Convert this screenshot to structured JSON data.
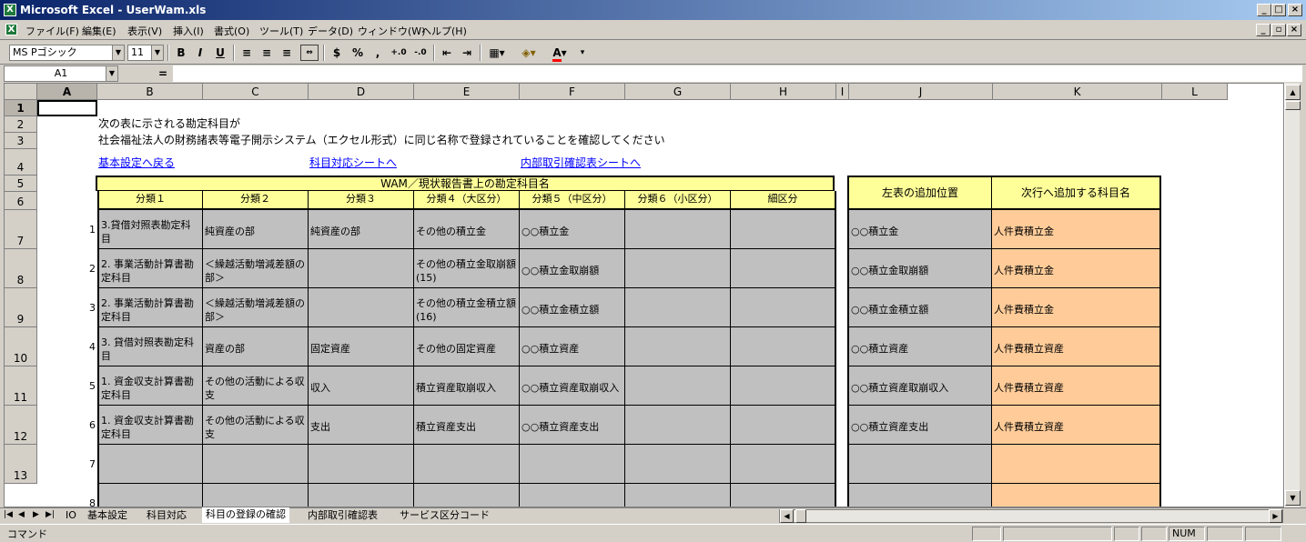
{
  "window": {
    "title": "Microsoft Excel - UserWam.xls"
  },
  "menu": [
    "ファイル(F)",
    "編集(E)",
    "表示(V)",
    "挿入(I)",
    "書式(O)",
    "ツール(T)",
    "データ(D)",
    "ウィンドウ(W)",
    "ヘルプ(H)"
  ],
  "toolbar": {
    "font": "MS Pゴシック",
    "size": "11",
    "bold": "B",
    "italic": "I",
    "underline": "U",
    "percent": "%",
    "comma": ","
  },
  "formula": {
    "cell_ref": "A1",
    "equals": "=",
    "value": ""
  },
  "columns": [
    "A",
    "B",
    "C",
    "D",
    "E",
    "F",
    "G",
    "H",
    "I",
    "J",
    "K",
    "L"
  ],
  "rows": [
    "1",
    "2",
    "3",
    "4",
    "5",
    "6",
    "7",
    "8",
    "9",
    "10",
    "11",
    "12",
    "13"
  ],
  "text": {
    "line1": "次の表に示される勘定科目が",
    "line2": "社会福祉法人の財務諸表等電子開示システム（エクセル形式）に同じ名称で登録されていることを確認してください"
  },
  "links": [
    "基本設定へ戻る",
    "科目対応シートへ",
    "内部取引確認表シートへ"
  ],
  "table": {
    "main_title": "WAM／現状報告書上の勘定科目名",
    "headers": [
      "分類１",
      "分類２",
      "分類３",
      "分類４（大区分）",
      "分類５（中区分）",
      "分類６（小区分）",
      "細区分"
    ],
    "right_headers": [
      "左表の追加位置",
      "次行へ追加する科目名"
    ],
    "rows": [
      {
        "no": "1",
        "c": [
          "3.貸借対照表勘定科目",
          "純資産の部",
          "純資産の部",
          "その他の積立金",
          "○○積立金",
          "",
          ""
        ],
        "pos": "○○積立金",
        "add": "人件費積立金"
      },
      {
        "no": "2",
        "c": [
          "2. 事業活動計算書勘定科目",
          "＜繰越活動増減差額の部＞",
          "",
          "その他の積立金取崩額(15)",
          "○○積立金取崩額",
          "",
          ""
        ],
        "pos": "○○積立金取崩額",
        "add": "人件費積立金"
      },
      {
        "no": "3",
        "c": [
          "2. 事業活動計算書勘定科目",
          "＜繰越活動増減差額の部＞",
          "",
          "その他の積立金積立額(16)",
          "○○積立金積立額",
          "",
          ""
        ],
        "pos": "○○積立金積立額",
        "add": "人件費積立金"
      },
      {
        "no": "4",
        "c": [
          "3. 貸借対照表勘定科目",
          "資産の部",
          "固定資産",
          "その他の固定資産",
          "○○積立資産",
          "",
          ""
        ],
        "pos": "○○積立資産",
        "add": "人件費積立資産"
      },
      {
        "no": "5",
        "c": [
          "1. 資金収支計算書勘定科目",
          "その他の活動による収支",
          "収入",
          "積立資産取崩収入",
          "○○積立資産取崩収入",
          "",
          ""
        ],
        "pos": "○○積立資産取崩収入",
        "add": "人件費積立資産"
      },
      {
        "no": "6",
        "c": [
          "1. 資金収支計算書勘定科目",
          "その他の活動による収支",
          "支出",
          "積立資産支出",
          "○○積立資産支出",
          "",
          ""
        ],
        "pos": "○○積立資産支出",
        "add": "人件費積立資産"
      },
      {
        "no": "7",
        "c": [
          "",
          "",
          "",
          "",
          "",
          "",
          ""
        ],
        "pos": "",
        "add": ""
      },
      {
        "no": "8",
        "c": [
          "",
          "",
          "",
          "",
          "",
          "",
          ""
        ],
        "pos": "",
        "add": ""
      }
    ]
  },
  "sheet_tabs": [
    "IO",
    "基本設定",
    "科目対応",
    "科目の登録の確認",
    "内部取引確認表",
    "サービス区分コード"
  ],
  "status": {
    "mode": "コマンド",
    "num": "NUM"
  },
  "colors": {
    "title_start": "#0a246a",
    "header_yellow": "#ffff99",
    "peach": "#ffcc99",
    "gray_cell": "#c0c0c0",
    "link": "#0000ff"
  }
}
